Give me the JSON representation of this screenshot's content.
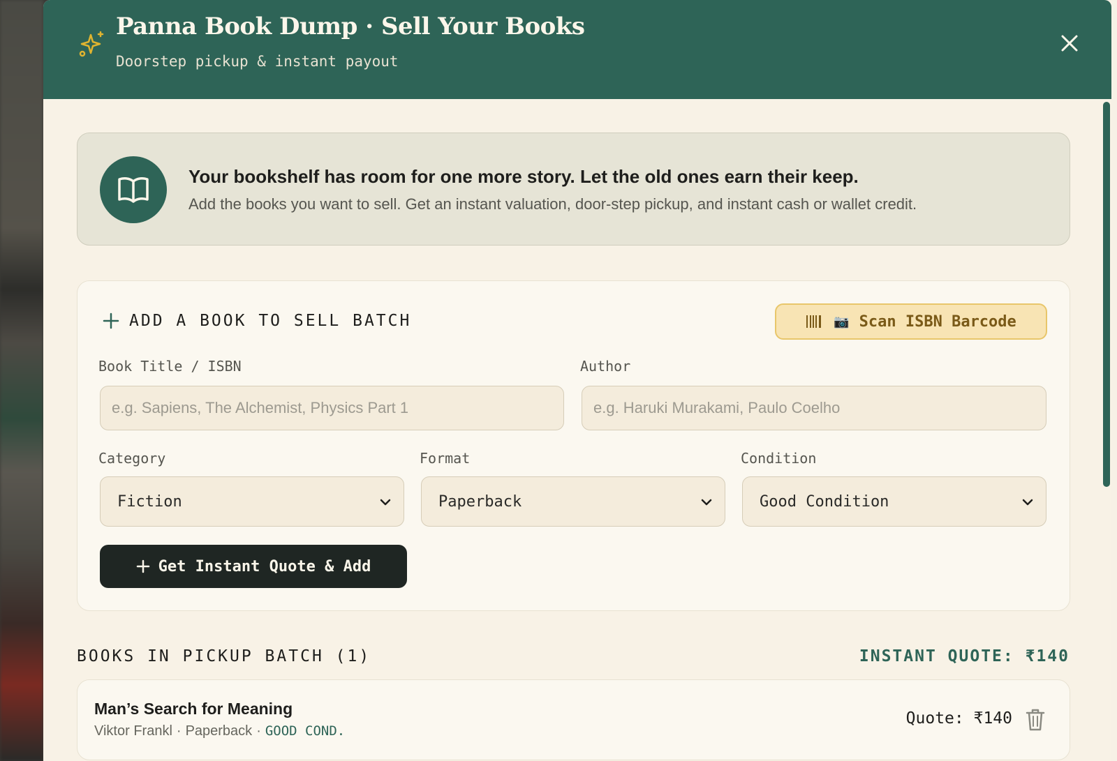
{
  "header": {
    "title": "Panna Book Dump · Sell Your Books",
    "subtitle": "Doorstep pickup & instant payout",
    "close_icon": "close-icon",
    "brand_icon": "sparkle-icon"
  },
  "intro": {
    "heading": "Your bookshelf has room for one more story. Let the old ones earn their keep.",
    "text": "Add the books you want to sell. Get an instant valuation, door-step pickup, and instant cash or wallet credit.",
    "icon": "open-book-icon"
  },
  "add_form": {
    "heading": "ADD A BOOK TO SELL BATCH",
    "scan_label": "Scan ISBN Barcode",
    "scan_glyph": "📷",
    "title_label": "Book Title / ISBN",
    "title_value": "",
    "title_placeholder": "e.g. Sapiens, The Alchemist, Physics Part 1",
    "author_label": "Author",
    "author_value": "",
    "author_placeholder": "e.g. Haruki Murakami, Paulo Coelho",
    "category_label": "Category",
    "category_value": "Fiction",
    "format_label": "Format",
    "format_value": "Paperback",
    "condition_label": "Condition",
    "condition_value": "Good Condition",
    "submit_label": "Get Instant Quote & Add"
  },
  "batch": {
    "heading": "BOOKS IN PICKUP BATCH (1)",
    "total": "INSTANT QUOTE: ₹140",
    "items": [
      {
        "title": "Man’s Search for Meaning",
        "author": "Viktor Frankl",
        "format": "Paperback",
        "condition": "GOOD COND.",
        "quote": "Quote: ₹140"
      }
    ]
  },
  "colors": {
    "header_bg": "#2e6457",
    "accent": "#2e6457",
    "gold": "#d4a52a",
    "dark_button": "#1f2623",
    "scan_bg": "#f8e4b4",
    "page_bg": "#f8f2e6"
  }
}
